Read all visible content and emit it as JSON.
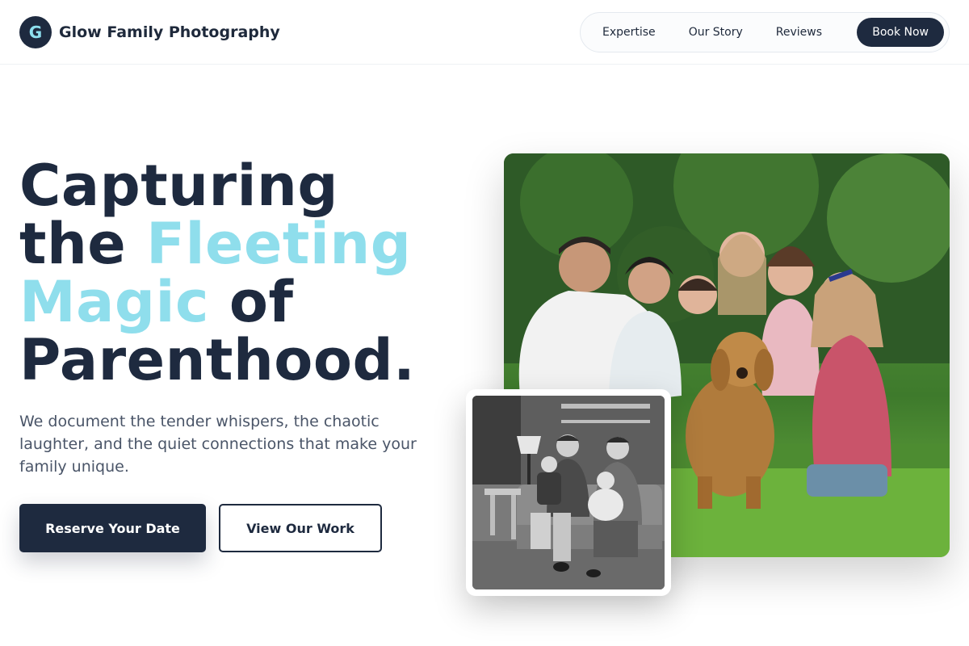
{
  "brand": {
    "logo_letter": "G",
    "name": "Glow Family Photography"
  },
  "nav": {
    "links": [
      "Expertise",
      "Our Story",
      "Reviews"
    ],
    "cta": "Book Now"
  },
  "hero": {
    "headline": {
      "line1": "Capturing",
      "line2_a": "the",
      "line2_accent": "Fleeting",
      "line3_accent": "Magic",
      "line3_b": "of",
      "line4": "Parenthood."
    },
    "subtitle": "We document the tender whispers, the chaotic laughter, and the quiet connections that make your family unique.",
    "primary_button": "Reserve Your Date",
    "secondary_button": "View Our Work"
  },
  "images": {
    "main": "family-with-dog-outdoor-photo",
    "inset": "vintage-black-and-white-family-photo"
  },
  "colors": {
    "navy": "#1e2a3f",
    "accent": "#8fdeec",
    "body_text": "#4a5568"
  }
}
